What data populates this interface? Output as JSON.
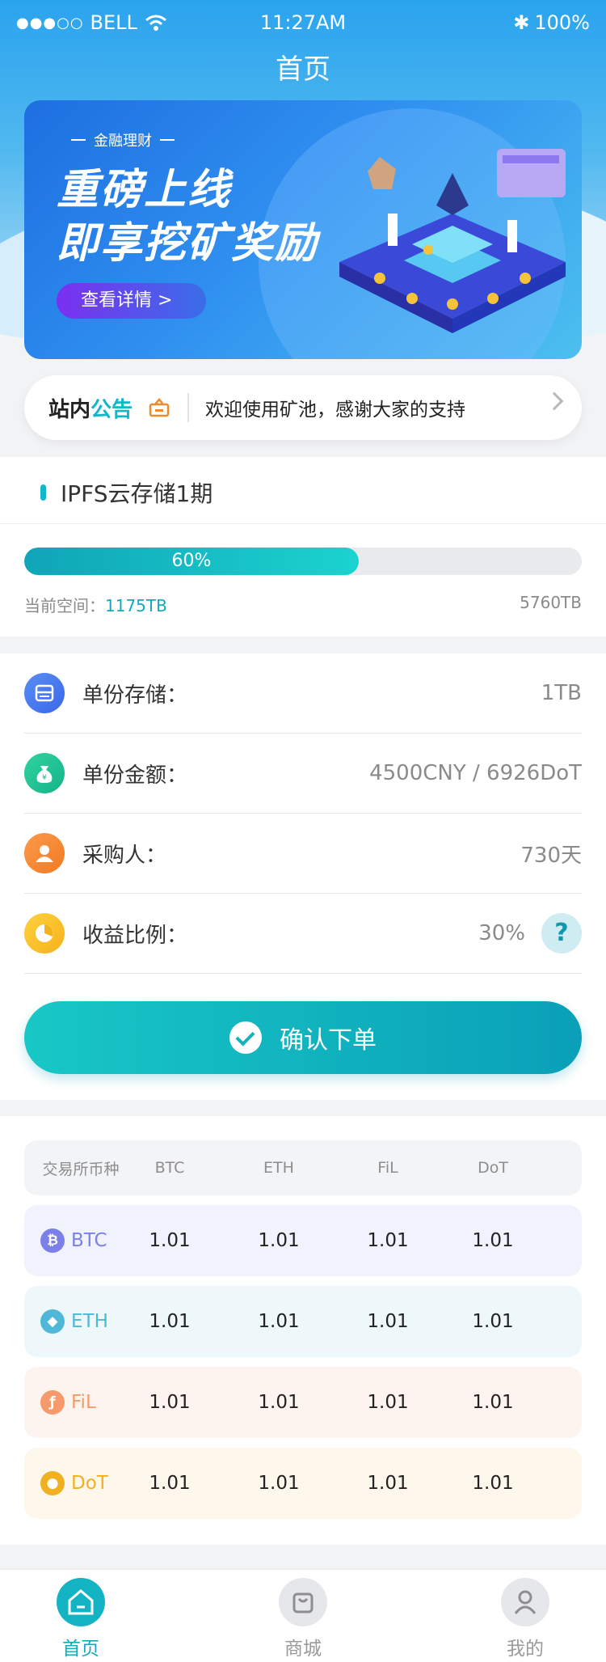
{
  "status_bar": {
    "carrier": "BELL",
    "time": "11:27AM",
    "battery": "100%"
  },
  "nav": {
    "title": "首页"
  },
  "banner": {
    "tag": "金融理财",
    "headline_line1": "重磅上线",
    "headline_line2": "即享挖矿奖励",
    "cta": "查看详情 >"
  },
  "notice": {
    "label_a": "站内",
    "label_b": "公告",
    "text": "欢迎使用矿池，感谢大家的支持"
  },
  "product": {
    "title": "IPFS云存储1期",
    "progress_label": "60%",
    "progress_value": 0.6,
    "current_label": "当前空间：",
    "current_value": "1175TB",
    "total": "5760TB"
  },
  "details": {
    "rows": [
      {
        "label": "单份存储：",
        "value": "1TB"
      },
      {
        "label": "单份金额：",
        "value": "4500CNY / 6926DoT"
      },
      {
        "label": "采购人：",
        "value": "730天"
      },
      {
        "label": "收益比例：",
        "value": "30%"
      }
    ],
    "help": "?",
    "confirm": "确认下单"
  },
  "table": {
    "headers": [
      "交易所币种",
      "BTC",
      "ETH",
      "FiL",
      "DoT"
    ],
    "rows": [
      {
        "coin": "BTC",
        "values": [
          "1.01",
          "1.01",
          "1.01",
          "1.01"
        ]
      },
      {
        "coin": "ETH",
        "values": [
          "1.01",
          "1.01",
          "1.01",
          "1.01"
        ]
      },
      {
        "coin": "FiL",
        "values": [
          "1.01",
          "1.01",
          "1.01",
          "1.01"
        ]
      },
      {
        "coin": "DoT",
        "values": [
          "1.01",
          "1.01",
          "1.01",
          "1.01"
        ]
      }
    ]
  },
  "tabbar": {
    "home": "首页",
    "mall": "商城",
    "mine": "我的"
  },
  "colors": {
    "accent": "#13b8c8",
    "btc_color": "#7b7fe8",
    "eth_color": "#4fb8d8",
    "fil_color": "#f59a6a",
    "dot_color": "#f0b020"
  }
}
